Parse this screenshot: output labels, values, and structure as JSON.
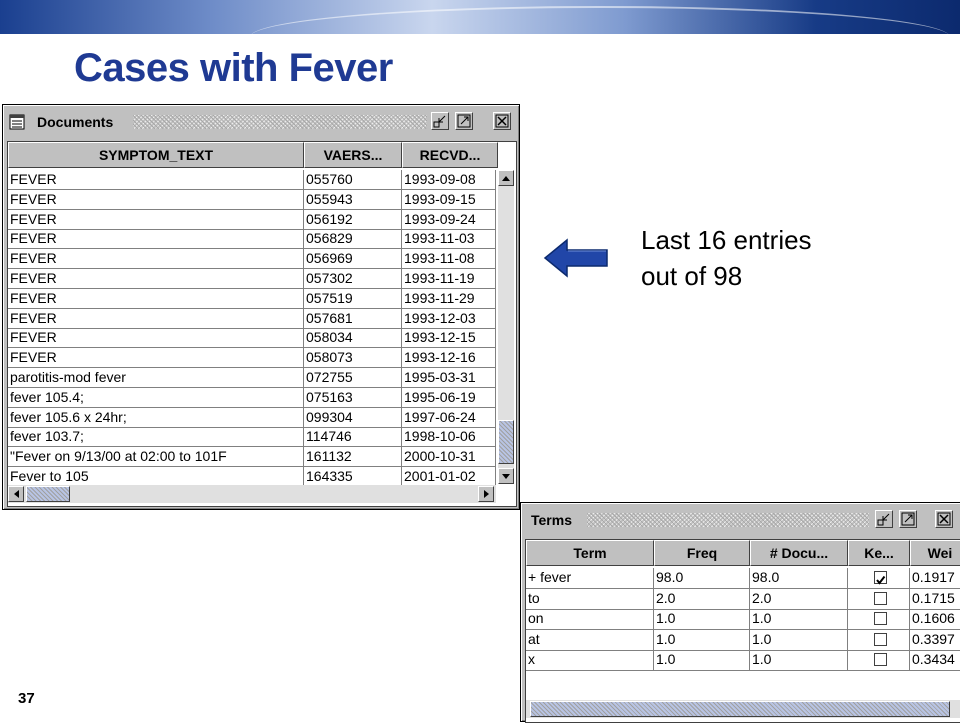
{
  "slide": {
    "title": "Cases with Fever",
    "page_number": "37",
    "note_line1": "Last 16 entries",
    "note_line2": "out of 98"
  },
  "documents_window": {
    "title": "Documents",
    "columns": [
      "SYMPTOM_TEXT",
      "VAERS...",
      "RECVD..."
    ],
    "rows": [
      [
        "FEVER",
        "055760",
        "1993-09-08"
      ],
      [
        "FEVER",
        "055943",
        "1993-09-15"
      ],
      [
        "FEVER",
        "056192",
        "1993-09-24"
      ],
      [
        "FEVER",
        "056829",
        "1993-11-03"
      ],
      [
        "FEVER",
        "056969",
        "1993-11-08"
      ],
      [
        "FEVER",
        "057302",
        "1993-11-19"
      ],
      [
        "FEVER",
        "057519",
        "1993-11-29"
      ],
      [
        "FEVER",
        "057681",
        "1993-12-03"
      ],
      [
        "FEVER",
        "058034",
        "1993-12-15"
      ],
      [
        "FEVER",
        "058073",
        "1993-12-16"
      ],
      [
        "parotitis-mod fever",
        "072755",
        "1995-03-31"
      ],
      [
        "fever 105.4;",
        "075163",
        "1995-06-19"
      ],
      [
        "fever 105.6 x 24hr;",
        "099304",
        "1997-06-24"
      ],
      [
        "fever 103.7;",
        "114746",
        "1998-10-06"
      ],
      [
        "\"Fever on 9/13/00 at 02:00 to 101F",
        "161132",
        "2000-10-31"
      ],
      [
        "Fever to 105",
        "164335",
        "2001-01-02"
      ]
    ]
  },
  "terms_window": {
    "title": "Terms",
    "columns": [
      "Term",
      "Freq",
      "# Docu...",
      "Ke...",
      "Wei"
    ],
    "rows": [
      {
        "term": "+ fever",
        "freq": "98.0",
        "docs": "98.0",
        "keep": true,
        "weight": "0.1917"
      },
      {
        "term": "to",
        "freq": "2.0",
        "docs": "2.0",
        "keep": false,
        "weight": "0.1715"
      },
      {
        "term": "on",
        "freq": "1.0",
        "docs": "1.0",
        "keep": false,
        "weight": "0.1606"
      },
      {
        "term": "at",
        "freq": "1.0",
        "docs": "1.0",
        "keep": false,
        "weight": "0.3397"
      },
      {
        "term": "x",
        "freq": "1.0",
        "docs": "1.0",
        "keep": false,
        "weight": "0.3434"
      }
    ]
  },
  "icons": [
    "document-list-icon",
    "minimize-icon",
    "maximize-icon",
    "close-icon",
    "scroll-up-icon",
    "scroll-down-icon",
    "scroll-left-icon",
    "scroll-right-icon",
    "left-arrow-icon",
    "checkmark-icon"
  ],
  "colors": {
    "title": "#1f3a93",
    "arrow": "#2146a8",
    "frame": "#c0c0c0"
  }
}
